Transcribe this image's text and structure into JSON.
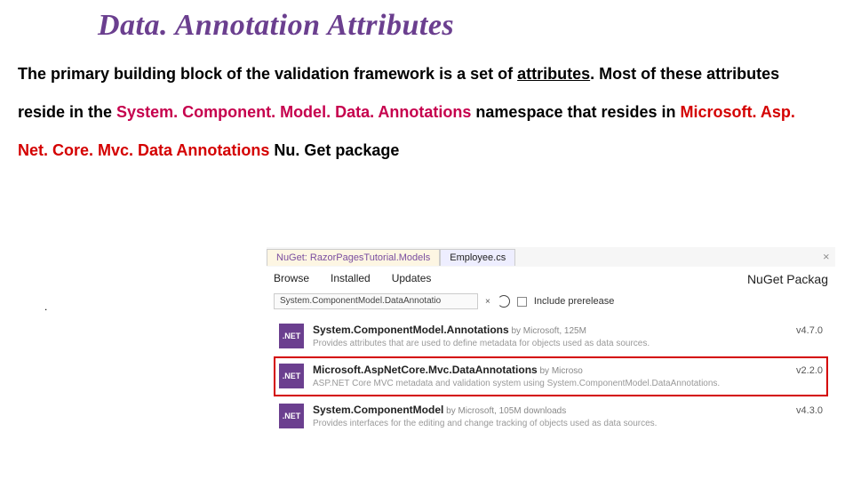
{
  "slide": {
    "title": "Data. Annotation Attributes",
    "p1": "The primary building block of the validation framework is a set of ",
    "p1u": "attributes",
    "p2a": ".  Most of these attributes reside in the ",
    "p2ns": "System. Component. Model. Data. Annotations",
    "p2b": " namespace that resides in ",
    "p2pkg": "Microsoft. Asp. Net. Core. Mvc. Data Annotations ",
    "p2c": " Nu. Get package ",
    "dot": "."
  },
  "nuget": {
    "tab1": "NuGet: RazorPagesTutorial.Models",
    "tab2": "Employee.cs",
    "nav": {
      "browse": "Browse",
      "installed": "Installed",
      "updates": "Updates",
      "brand": "NuGet Packag"
    },
    "search": {
      "value": "System.ComponentModel.DataAnnotatio",
      "x": "×",
      "prerelease": "Include prerelease"
    },
    "items": [
      {
        "badge": ".NET",
        "name": "System.ComponentModel.Annotations",
        "by": " by Microsoft, 125M",
        "ver": "v4.7.0",
        "desc": "Provides attributes that are used to define metadata for objects used as data sources.",
        "hl": false
      },
      {
        "badge": ".NET",
        "name": "Microsoft.AspNetCore.Mvc.DataAnnotations",
        "by": " by Microso",
        "ver": "v2.2.0",
        "desc": "ASP.NET Core MVC metadata and validation system using System.ComponentModel.DataAnnotations.",
        "hl": true
      },
      {
        "badge": ".NET",
        "name": "System.ComponentModel",
        "by": " by Microsoft, 105M downloads",
        "ver": "v4.3.0",
        "desc": "Provides interfaces for the editing and change tracking of objects used as data sources.",
        "hl": false
      }
    ]
  }
}
